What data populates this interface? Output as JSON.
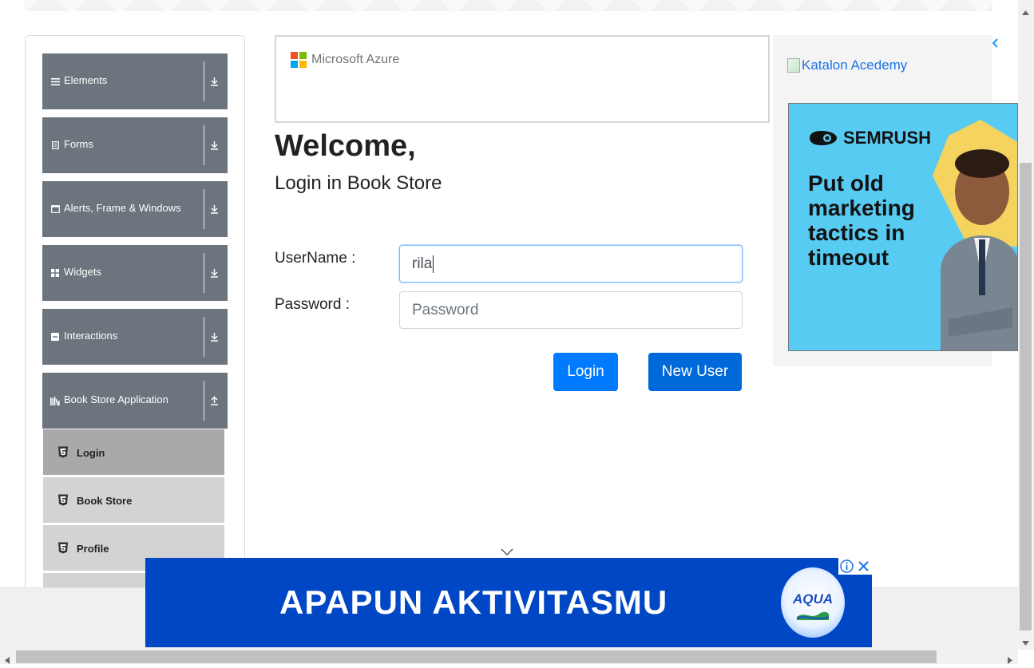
{
  "sidebar": {
    "menu": [
      {
        "label": "Elements",
        "icon": "hamburger-icon"
      },
      {
        "label": "Forms",
        "icon": "form-icon"
      },
      {
        "label": "Alerts, Frame & Windows",
        "icon": "window-icon"
      },
      {
        "label": "Widgets",
        "icon": "grid-icon"
      },
      {
        "label": "Interactions",
        "icon": "interaction-icon"
      },
      {
        "label": "Book Store Application",
        "icon": "books-icon"
      }
    ],
    "subitems": [
      {
        "label": "Login",
        "active": true
      },
      {
        "label": "Book Store",
        "active": false
      },
      {
        "label": "Profile",
        "active": false
      }
    ]
  },
  "ad_top": {
    "brand": "Microsoft Azure"
  },
  "main": {
    "welcome": "Welcome,",
    "subtitle": "Login in Book Store",
    "username_label": "UserName :",
    "username_value": "rila",
    "password_label": "Password :",
    "password_placeholder": "Password",
    "login_button": "Login",
    "new_user_button": "New User"
  },
  "right_ad": {
    "katalon_alt": "Katalon Acedemy",
    "semrush_brand": "SEMRUSH",
    "semrush_headline": "Put old marketing tactics in timeout"
  },
  "bottom_ad": {
    "text": "APAPUN AKTIVITASMU",
    "brand": "AQUA"
  },
  "colors": {
    "primary": "#007bff",
    "menu_bg": "#6c757d",
    "subitem_bg": "#d3d3d3",
    "subitem_active": "#a9a9a9",
    "bottom_ad_bg": "#0047c6",
    "semrush_bg": "#58cbf2"
  }
}
